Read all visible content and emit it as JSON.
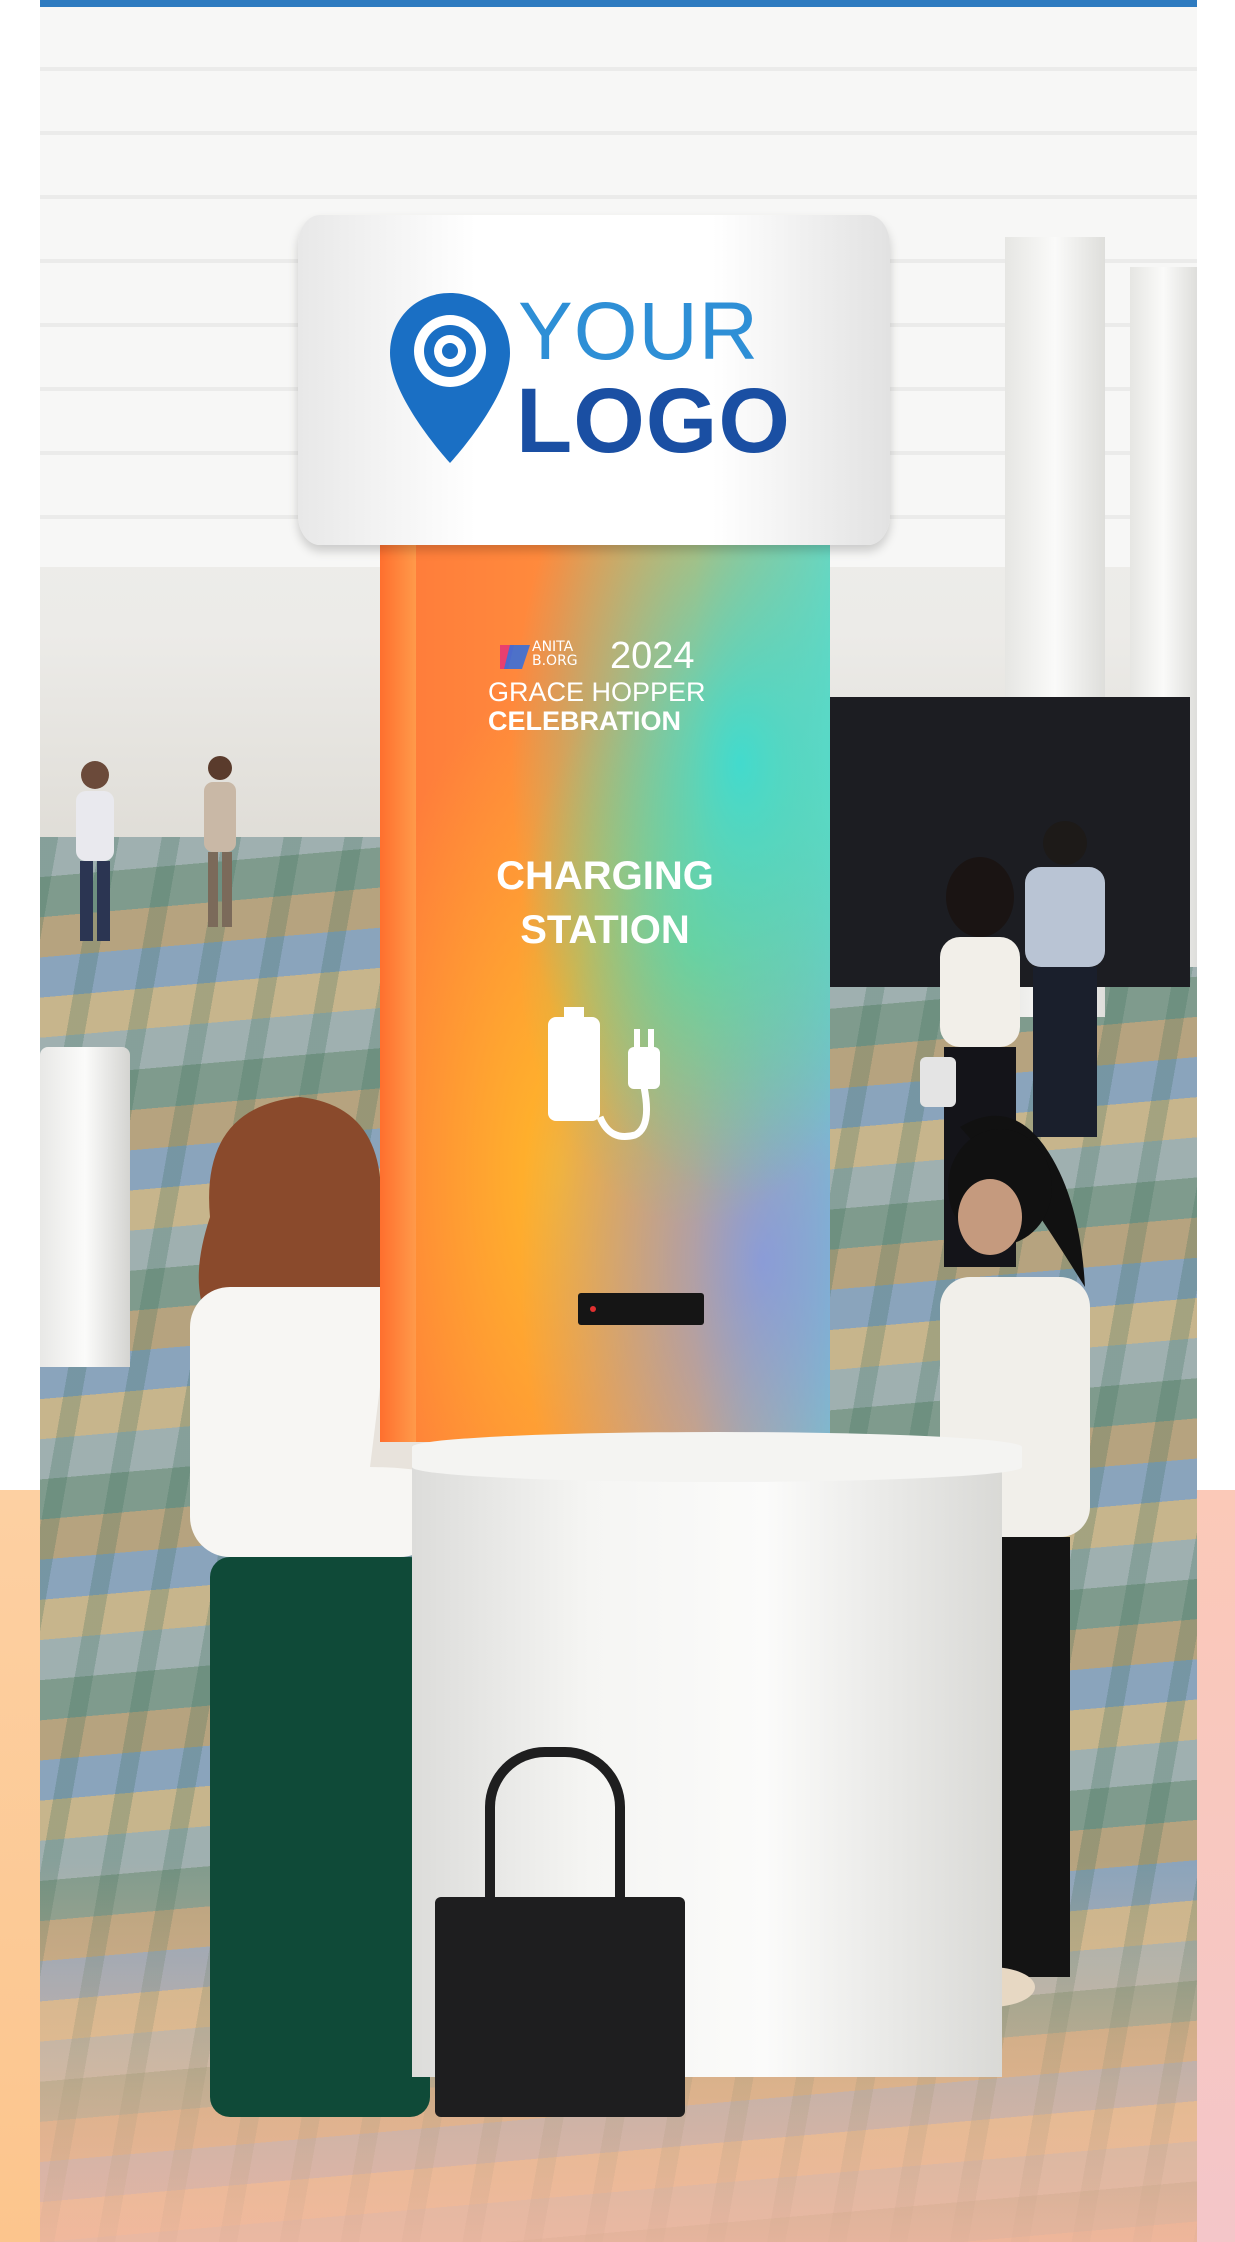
{
  "sign": {
    "logo_line1": "YOUR",
    "logo_line2": "LOGO",
    "logo_icon": "location-pin-icon"
  },
  "tower": {
    "brand_org": "ANITA B.ORG",
    "brand_year": "2024",
    "brand_line1": "GRACE HOPPER",
    "brand_line2": "CELEBRATION",
    "title_line1": "CHARGING",
    "title_line2": "STATION",
    "icon": "battery-plug-icon"
  },
  "colors": {
    "logo_light_blue": "#2e8fd6",
    "logo_dark_blue": "#1a4fa3",
    "top_bar": "#2e7bc0",
    "tower_orange": "#ff8c3d",
    "tower_teal": "#3cdcd2"
  }
}
